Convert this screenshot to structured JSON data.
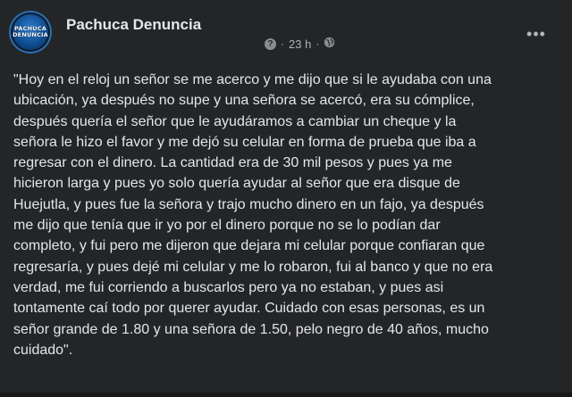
{
  "post": {
    "page_name": "Pachuca Denuncia",
    "avatar_text": "PACHUCA DENUNCIA",
    "help_icon": "?",
    "separator": "·",
    "timestamp": "23 h",
    "audience_icon": "globe-icon",
    "more_label": "•••",
    "text": "\"Hoy en el reloj un señor se me acerco y me dijo que si le ayudaba con una\nubicación, ya después no supe y una señora se acercó, era su cómplice,\ndespués quería el señor que le ayudáramos a cambiar un cheque y la\nseñora le hizo el favor y me dejó su celular en forma de prueba que iba a\nregresar con el dinero. La cantidad era de 30 mil pesos y pues ya me\nhicieron larga y pues yo solo quería ayudar al señor que era disque de\nHuejutla, y pues fue la señora y trajo mucho dinero en un fajo, ya después\nme dijo que tenía que ir yo por el dinero porque no se lo podían dar\ncompleto, y fui pero me dijeron que dejara mi celular porque confiaran que\nregresaría, y pues dejé mi celular y me lo robaron, fui al banco y que no era\nverdad, me fui corriendo a buscarlos pero ya no estaban, y pues asi\ntontamente caí todo por querer ayudar. Cuidado con esas personas, es un\nseñor grande de 1.80 y una señora de 1.50, pelo negro de 40 años, mucho\ncuidado\"."
  },
  "colors": {
    "card_background": "#242526",
    "page_background": "#18191a",
    "primary_text": "#e4e6eb",
    "secondary_text": "#b0b3b8"
  }
}
